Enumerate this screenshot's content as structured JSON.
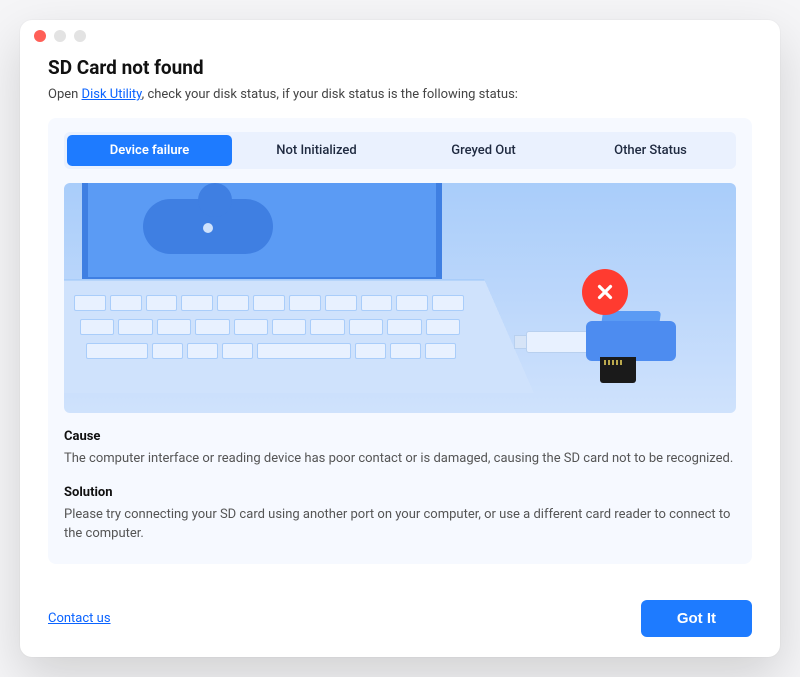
{
  "header": {
    "title": "SD Card not found",
    "subtitle_prefix": "Open ",
    "subtitle_link": "Disk Utility",
    "subtitle_suffix": ", check your disk status, if your disk status is the following status:"
  },
  "tabs": [
    {
      "label": "Device failure",
      "active": true
    },
    {
      "label": "Not Initialized",
      "active": false
    },
    {
      "label": "Greyed Out",
      "active": false
    },
    {
      "label": "Other Status",
      "active": false
    }
  ],
  "illustration": {
    "error_icon": "x-circle-icon"
  },
  "sections": {
    "cause_heading": "Cause",
    "cause_text": "The computer interface or reading device has poor contact or is damaged, causing the SD card not to be recognized.",
    "solution_heading": "Solution",
    "solution_text": "Please try connecting your SD card using another port on your computer, or use a different card reader to connect to the computer."
  },
  "footer": {
    "contact_label": "Contact us",
    "primary_button": "Got It"
  },
  "colors": {
    "accent": "#1e7bff",
    "error": "#ff3b30",
    "panel_bg": "#f6f9ff"
  }
}
